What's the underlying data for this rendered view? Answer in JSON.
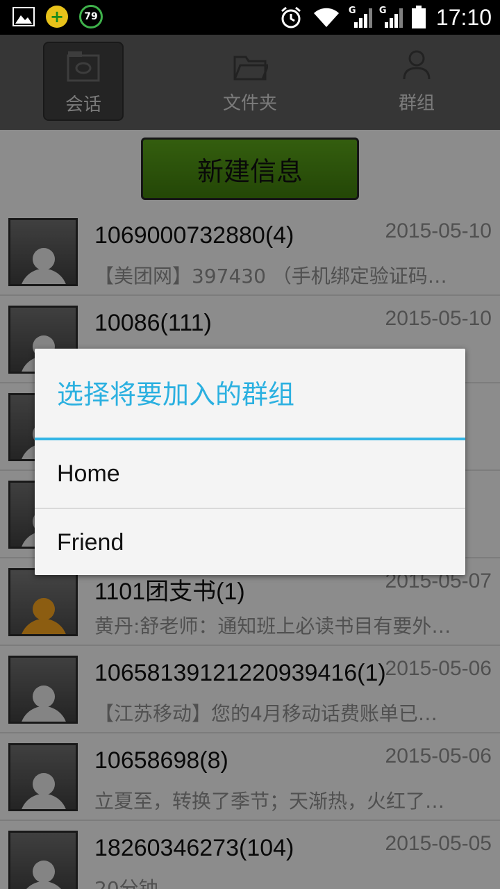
{
  "status_bar": {
    "battery_level_text": "79",
    "time": "17:10",
    "network_label_1": "G",
    "network_label_2": "G"
  },
  "tabs": [
    {
      "label": "会话",
      "icon": "chat-icon",
      "active": true
    },
    {
      "label": "文件夹",
      "icon": "folder-icon",
      "active": false
    },
    {
      "label": "群组",
      "icon": "person-icon",
      "active": false
    }
  ],
  "new_message_button": "新建信息",
  "conversations": [
    {
      "name": "1069000732880(4)",
      "date": "2015-05-10",
      "preview": "【美团网】397430 （手机绑定验证码…"
    },
    {
      "name": "10086(111)",
      "date": "2015-05-10",
      "preview": ""
    },
    {
      "name": "",
      "date": "",
      "preview": ""
    },
    {
      "name": "",
      "date": "",
      "preview": ""
    },
    {
      "name": "1101团支书(1)",
      "date": "2015-05-07",
      "preview": "黄丹:舒老师：通知班上必读书目有要外…"
    },
    {
      "name": "10658139121220939416(1)",
      "date": "2015-05-06",
      "preview": "【江苏移动】您的4月移动话费账单已…"
    },
    {
      "name": "10658698(8)",
      "date": "2015-05-06",
      "preview": "立夏至，转换了季节；天渐热，火红了…"
    },
    {
      "name": "18260346273(104)",
      "date": "2015-05-05",
      "preview": "20分钟"
    }
  ],
  "dialog": {
    "title": "选择将要加入的群组",
    "items": [
      "Home",
      "Friend"
    ]
  },
  "colors": {
    "accent": "#33b5e5",
    "button_green": "#4f8f14",
    "tab_bar": "#5e5e5e"
  }
}
